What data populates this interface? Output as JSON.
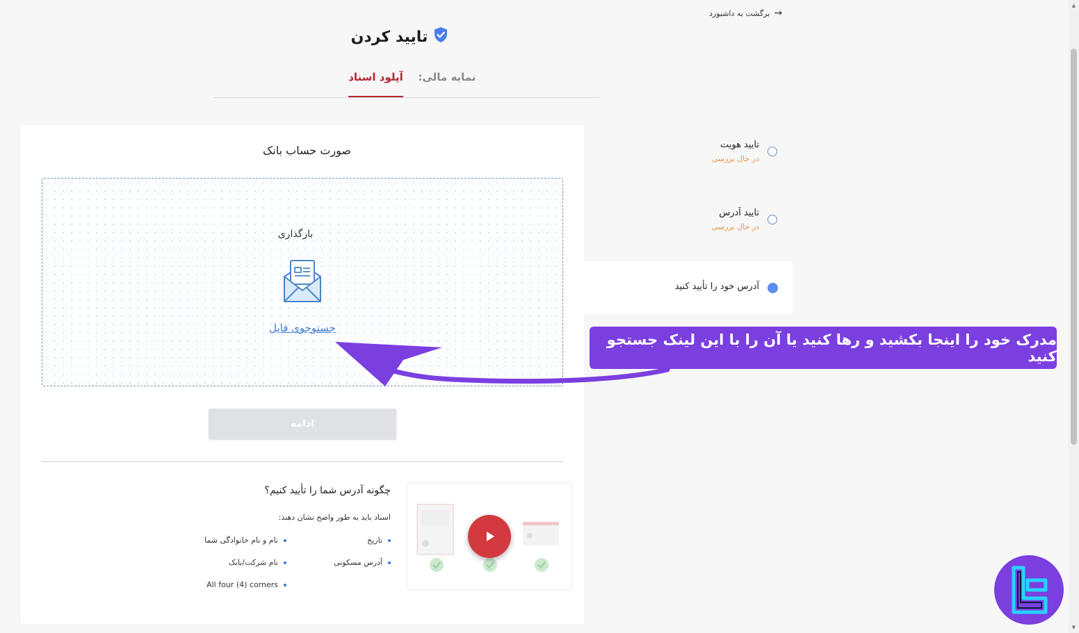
{
  "header": {
    "back_label": "برگشت به داشبورد",
    "title": "تایید کردن"
  },
  "tabs": [
    {
      "label": "نمایه مالی:"
    },
    {
      "label": "آپلود اسناد",
      "active": true
    }
  ],
  "upload": {
    "section_title": "صورت حساب بانک",
    "label": "بارگذاری",
    "browse_link": "جستوجوی فایل",
    "continue_button": "ادامه"
  },
  "help": {
    "title": "چگونه آدرس شما را تأیید کنیم؟",
    "intro": "اسناد باید به طور واضح نشان دهند:",
    "items": [
      "تاریخ",
      "نام و نام خانوادگی شما",
      "آدرس مسکونی",
      "نام شرکت/بانک",
      "All four (4) corners"
    ]
  },
  "steps": [
    {
      "name": "تایید هویت",
      "status": "در حال بررسی"
    },
    {
      "name": "تایید آدرس",
      "status": "در حال بررسی"
    },
    {
      "name": "آدرس خود را تأیید کنید",
      "active": true
    }
  ],
  "callout": {
    "text": "مدرک خود را اینجا بکشید و رها کنید یا آن را با این لینک جستجو کنید"
  },
  "colors": {
    "accent_red": "#b3262e",
    "link_blue": "#3b7bd0",
    "pending_orange": "#e8923a",
    "callout_purple": "#7b3fe0",
    "active_dot": "#5b8ef0",
    "play_red": "#d23a3f"
  }
}
